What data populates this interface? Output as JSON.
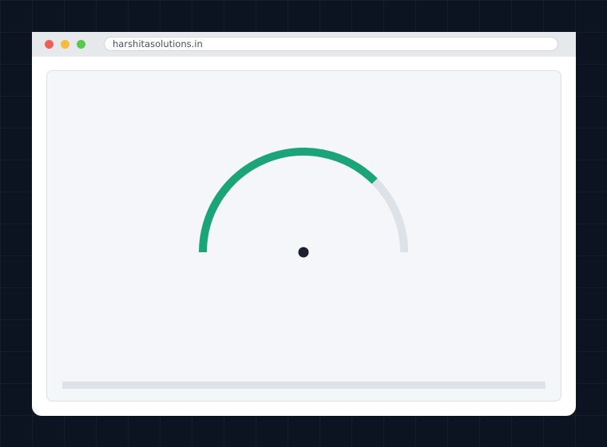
{
  "browser": {
    "url": "harshitasolutions.in",
    "buttons": [
      "close",
      "minimize",
      "maximize"
    ]
  },
  "gauge": {
    "value": 0.75,
    "fill_color": "#1ba576",
    "track_color": "#dde1e8",
    "needle_hub_color": "#1a2030"
  },
  "progress_bar": {
    "value": 0,
    "color": "#dde1e8"
  }
}
